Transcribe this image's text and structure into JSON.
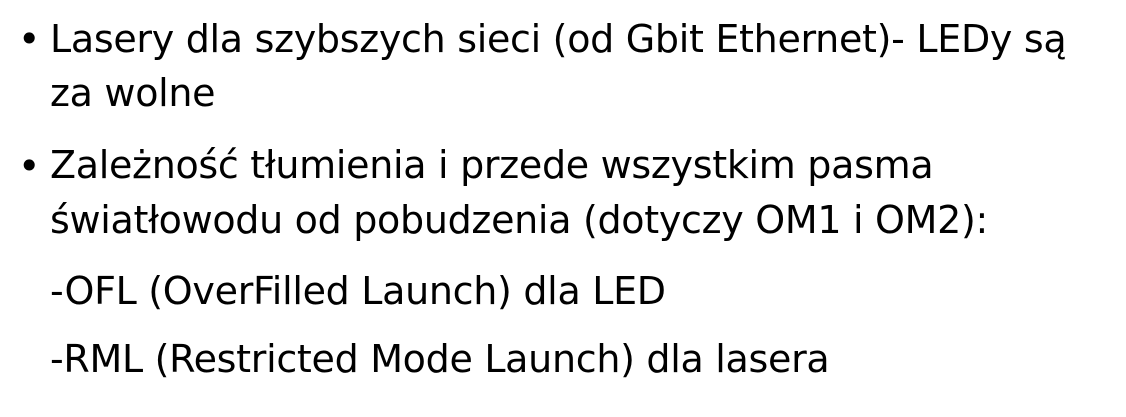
{
  "bullets": [
    {
      "marker": "•",
      "lines": [
        "Lasery dla szybszych sieci (od Gbit Ethernet)- LEDy są",
        "za wolne"
      ]
    },
    {
      "marker": "•",
      "lines": [
        "Zależność tłumienia i przede wszystkim pasma",
        "światłowodu od pobudzenia (dotyczy OM1 i OM2):"
      ]
    }
  ],
  "sub_items": [
    "-OFL (OverFilled Launch) dla LED",
    "-RML (Restricted Mode Launch) dla lasera"
  ]
}
